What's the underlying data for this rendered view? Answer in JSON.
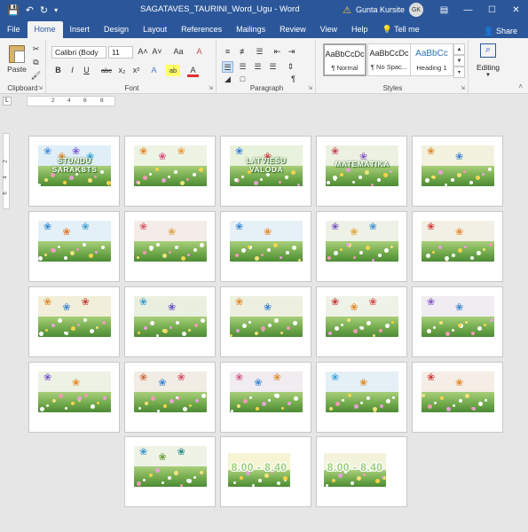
{
  "window": {
    "title": "SAGATAVES_TAURINI_Word_Ugu  -  Word",
    "user_name": "Gunta Kursite",
    "user_initials": "GK",
    "quick_access": [
      "save-icon",
      "undo-icon",
      "redo-icon",
      "customize-icon"
    ]
  },
  "tabs": [
    "File",
    "Home",
    "Insert",
    "Design",
    "Layout",
    "References",
    "Mailings",
    "Review",
    "View",
    "Help"
  ],
  "active_tab": "Home",
  "tell_me": "Tell me",
  "share": "Share",
  "ribbon": {
    "clipboard": {
      "label": "Clipboard",
      "paste": "Paste"
    },
    "font": {
      "label": "Font",
      "font_name": "Calibri (Body",
      "font_size": "11",
      "grow": "A˄",
      "shrink": "A˅",
      "case": "Aa",
      "clear": "A",
      "bold": "B",
      "italic": "I",
      "underline": "U",
      "strike": "abc",
      "subscript": "x₂",
      "superscript": "x²",
      "effects": "A",
      "highlight": "ab",
      "color": "A"
    },
    "paragraph": {
      "label": "Paragraph",
      "pilcrow": "¶"
    },
    "styles": {
      "label": "Styles",
      "items": [
        {
          "sample": "AaBbCcDc",
          "name": "¶ Normal"
        },
        {
          "sample": "AaBbCcDc",
          "name": "¶ No Spac..."
        },
        {
          "sample": "AaBbCc",
          "name": "Heading 1"
        }
      ]
    },
    "editing": {
      "label": "Editing"
    }
  },
  "ruler": {
    "marks": [
      "2",
      "4",
      "6",
      "8"
    ],
    "vmarks": [
      "2",
      "4",
      "6"
    ],
    "tab_marker": "L"
  },
  "colors": {
    "title_bar": "#2b579a",
    "ribbon_bg": "#f3f3f3",
    "doc_bg": "#e6e6e6",
    "grass": "#6fa84a"
  },
  "pages": [
    {
      "text": "STUNDU SARAKSTS",
      "sky": "#dfeef7",
      "butterflies": [
        "#4a8fd6",
        "#e08a2a",
        "#7a5bd0",
        "#3aa1d8"
      ],
      "text_style": "title"
    },
    {
      "text": "",
      "sky": "#eef4e4",
      "butterflies": [
        "#e7862a",
        "#d94f7c",
        "#e99a3a"
      ],
      "text_style": ""
    },
    {
      "text": "LATVIEŠU VALODA",
      "sky": "#e9f2dc",
      "butterflies": [
        "#3a7fd6",
        "#d04a4a"
      ],
      "text_style": "title"
    },
    {
      "text": "MATEMĀTIKA",
      "sky": "#edf1e2",
      "butterflies": [
        "#c94a5a",
        "#8a5fc4"
      ],
      "text_style": "title"
    },
    {
      "text": "",
      "sky": "#f2f2df",
      "butterflies": [
        "#e28a2c",
        "#3f84cf"
      ],
      "text_style": ""
    },
    {
      "text": "",
      "sky": "#e3f0f7",
      "butterflies": [
        "#3a8ed1",
        "#e0772a",
        "#3fa0d0"
      ],
      "text_style": ""
    },
    {
      "text": "",
      "sky": "#f4ece8",
      "butterflies": [
        "#d95b6a",
        "#e0a04a"
      ],
      "text_style": ""
    },
    {
      "text": "",
      "sky": "#e6f0f7",
      "butterflies": [
        "#3b86d4",
        "#e58b2f"
      ],
      "text_style": ""
    },
    {
      "text": "",
      "sky": "#eef2e6",
      "butterflies": [
        "#7a56c8",
        "#e0a53a",
        "#3a92d4"
      ],
      "text_style": ""
    },
    {
      "text": "",
      "sky": "#f2efe4",
      "butterflies": [
        "#d63b3b",
        "#e58b2f"
      ],
      "text_style": ""
    },
    {
      "text": "",
      "sky": "#f1efd9",
      "butterflies": [
        "#e08a2a",
        "#3f86d0",
        "#c8413e"
      ],
      "text_style": ""
    },
    {
      "text": "",
      "sky": "#eaf0e0",
      "butterflies": [
        "#3aa0c8",
        "#6b4fc4"
      ],
      "text_style": ""
    },
    {
      "text": "",
      "sky": "#eef0df",
      "butterflies": [
        "#e08a2a",
        "#3b82d0"
      ],
      "text_style": ""
    },
    {
      "text": "",
      "sky": "#eef2e7",
      "butterflies": [
        "#c93a3a",
        "#e08a2a",
        "#d84a4a"
      ],
      "text_style": ""
    },
    {
      "text": "",
      "sky": "#efecf2",
      "butterflies": [
        "#8a5bc8",
        "#3f86d0"
      ],
      "text_style": ""
    },
    {
      "text": "",
      "sky": "#eef2e4",
      "butterflies": [
        "#7a5bd0",
        "#e28a2c"
      ],
      "text_style": ""
    },
    {
      "text": "",
      "sky": "#f1ece4",
      "butterflies": [
        "#d06a3a",
        "#3a86d0",
        "#d94f6a"
      ],
      "text_style": ""
    },
    {
      "text": "",
      "sky": "#f0ecf0",
      "butterflies": [
        "#d65b8a",
        "#3f86d0",
        "#e58b2f"
      ],
      "text_style": ""
    },
    {
      "text": "",
      "sky": "#e4f0f6",
      "butterflies": [
        "#3aa6e0",
        "#e08a2a"
      ],
      "text_style": ""
    },
    {
      "text": "",
      "sky": "#f4eee6",
      "butterflies": [
        "#d63b3b",
        "#e08a2a"
      ],
      "text_style": ""
    },
    {
      "text": "",
      "sky": "#eef3e6",
      "butterflies": [
        "#3a9ad0",
        "#6b9e3a",
        "#2d8a8a"
      ],
      "text_style": ""
    },
    {
      "text": "8.00 - 8.40",
      "sky": "#f7f4d4",
      "butterflies": [],
      "text_style": "time"
    },
    {
      "text": "8.00 - 8.40",
      "sky": "#f3f3dc",
      "butterflies": [],
      "text_style": "time"
    }
  ]
}
